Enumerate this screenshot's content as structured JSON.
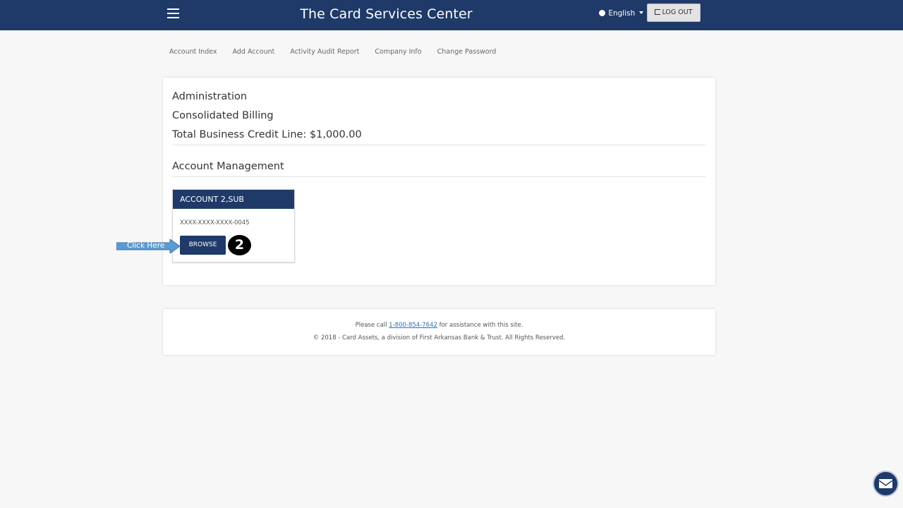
{
  "header": {
    "title": "The Card Services Center",
    "language": "English",
    "logout_label": "LOG OUT"
  },
  "subnav": {
    "items": [
      "Account Index",
      "Add Account",
      "Activity Audit Report",
      "Company Info",
      "Change Password"
    ]
  },
  "main": {
    "line1": "Administration",
    "line2": "Consolidated Billing",
    "line3": "Total Business Credit Line: $1,000.00",
    "section_title": "Account Management",
    "account": {
      "name": "ACCOUNT 2,SUB",
      "number": "XXXX-XXXX-XXXX-0045",
      "browse_label": "BROWSE"
    }
  },
  "annotation": {
    "callout_text": "Click Here",
    "step_number": "2"
  },
  "footer": {
    "call_prefix": "Please call",
    "phone": "1-800-854-7642",
    "call_suffix": "for assistance with this site.",
    "copyright": "© 2018 - Card Assets, a division of First Arkansas Bank & Trust. All Rights Reserved."
  },
  "colors": {
    "brand_navy": "#1f3a68",
    "callout_blue": "#5b9bd5",
    "link_blue": "#2a6ebb"
  }
}
